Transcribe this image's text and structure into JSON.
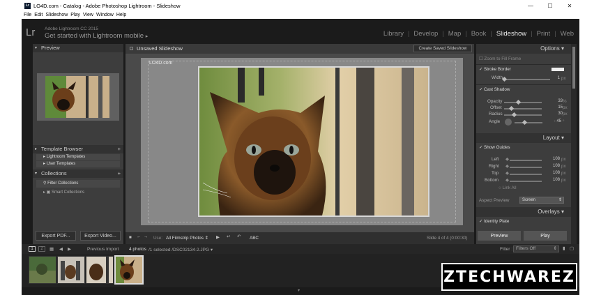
{
  "window": {
    "title": "LO4D.com - Catalog - Adobe Photoshop Lightroom - Slideshow",
    "icon_label": "Lr",
    "controls": [
      "minimize-icon",
      "maximize-icon",
      "close-icon"
    ]
  },
  "menu": [
    "File",
    "Edit",
    "Slideshow",
    "Play",
    "View",
    "Window",
    "Help"
  ],
  "identity": {
    "logo": "Lr",
    "line1": "Adobe Lightroom CC 2015",
    "line2": "Get started with Lightroom mobile"
  },
  "modules": [
    "Library",
    "Develop",
    "Map",
    "Book",
    "Slideshow",
    "Print",
    "Web"
  ],
  "active_module": "Slideshow",
  "left": {
    "preview_header": "Preview",
    "template_browser": "Template Browser",
    "templates": [
      "Lightroom Templates",
      "User Templates"
    ],
    "collections": "Collections",
    "collection_items": [
      "Filter Collections",
      "Smart Collections"
    ],
    "export_pdf": "Export PDF...",
    "export_video": "Export Video..."
  },
  "center": {
    "title": "Unsaved Slideshow",
    "save_button": "Create Saved Slideshow",
    "watermark": "LO4D.com",
    "use_label": "Use:",
    "use_value": "All Filmstrip Photos",
    "abc": "ABC",
    "slide_info": "Slide 4 of 4 (0:00:30)"
  },
  "right": {
    "options_header": "Options",
    "zoom_to_fill": "Zoom to Fill Frame",
    "stroke_border": "Stroke Border",
    "width_label": "Width",
    "width_value": "1",
    "cast_shadow": "Cast Shadow",
    "shadow_rows": [
      {
        "label": "Opacity",
        "value": "33",
        "unit": "%"
      },
      {
        "label": "Offset",
        "value": "15",
        "unit": "px"
      },
      {
        "label": "Radius",
        "value": "30",
        "unit": "px"
      },
      {
        "label": "Angle",
        "value": "- 45",
        "unit": "°"
      }
    ],
    "layout_header": "Layout",
    "show_guides": "Show Guides",
    "guide_rows": [
      {
        "label": "Left",
        "value": "108",
        "unit": "px"
      },
      {
        "label": "Right",
        "value": "108",
        "unit": "px"
      },
      {
        "label": "Top",
        "value": "108",
        "unit": "px"
      },
      {
        "label": "Bottom",
        "value": "108",
        "unit": "px"
      }
    ],
    "link_all": "Link All",
    "aspect_label": "Aspect Preview",
    "aspect_value": "Screen",
    "overlays_header": "Overlays",
    "identity_plate": "Identity Plate",
    "preview_button": "Preview",
    "play_button": "Play"
  },
  "filmstrip": {
    "page1": "1",
    "page2": "2",
    "source": "Previous Import",
    "count": "4 photos",
    "selected": "/1 selected /DSC02134-2.JPG",
    "filter_label": "Filter :",
    "filter_value": "Filters Off"
  },
  "logo_text": "ZTECHWAREZ"
}
